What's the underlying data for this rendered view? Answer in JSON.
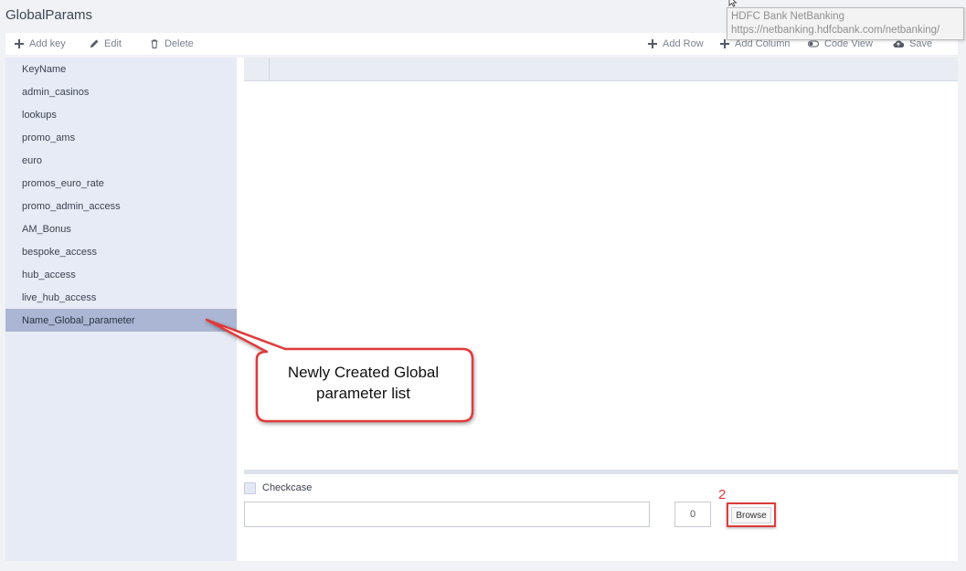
{
  "app": {
    "title": "GlobalParams"
  },
  "toolbar": {
    "add_key": "Add key",
    "edit": "Edit",
    "delete": "Delete",
    "add_row": "Add Row",
    "add_column": "Add Column",
    "code_view": "Code View",
    "save": "Save"
  },
  "sidebar": {
    "items": [
      {
        "label": "KeyName"
      },
      {
        "label": "admin_casinos"
      },
      {
        "label": "lookups"
      },
      {
        "label": "promo_ams"
      },
      {
        "label": "euro"
      },
      {
        "label": "promos_euro_rate"
      },
      {
        "label": "promo_admin_access"
      },
      {
        "label": "AM_Bonus"
      },
      {
        "label": "bespoke_access"
      },
      {
        "label": "hub_access"
      },
      {
        "label": "live_hub_access"
      },
      {
        "label": "Name_Global_parameter"
      }
    ],
    "selected_label": "Name_Global_parameter"
  },
  "bottom": {
    "checkcase_label": "Checkcase",
    "checkcase_checked": false,
    "file_value": "",
    "count_value": "0",
    "browse_label": "Browse"
  },
  "annotations": {
    "callout_line1": "Newly Created Global",
    "callout_line2": "parameter list",
    "step_number": "2"
  },
  "tooltip": {
    "title": "HDFC Bank NetBanking",
    "url": "https://netbanking.hdfcbank.com/netbanking/"
  },
  "colors": {
    "sidebar_bg": "#e7ebf5",
    "selected_bg": "#aab6d3",
    "annotation_red": "#e03a3a"
  }
}
